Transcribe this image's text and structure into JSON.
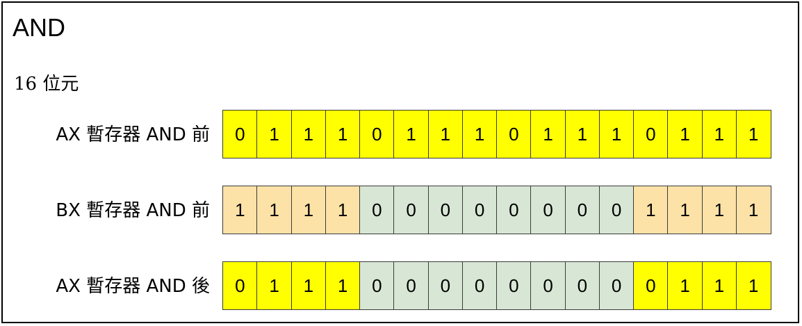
{
  "title": "AND",
  "subtitle": "16 位元",
  "colors": {
    "yellow": "#ffff00",
    "orange": "#fde2a8",
    "green": "#d8e7d5"
  },
  "rows": [
    {
      "label": "AX 暫存器 AND 前",
      "bits": [
        "0",
        "1",
        "1",
        "1",
        "0",
        "1",
        "1",
        "1",
        "0",
        "1",
        "1",
        "1",
        "0",
        "1",
        "1",
        "1"
      ],
      "fills": [
        "yellow",
        "yellow",
        "yellow",
        "yellow",
        "yellow",
        "yellow",
        "yellow",
        "yellow",
        "yellow",
        "yellow",
        "yellow",
        "yellow",
        "yellow",
        "yellow",
        "yellow",
        "yellow"
      ]
    },
    {
      "label": "BX 暫存器 AND 前",
      "bits": [
        "1",
        "1",
        "1",
        "1",
        "0",
        "0",
        "0",
        "0",
        "0",
        "0",
        "0",
        "0",
        "1",
        "1",
        "1",
        "1"
      ],
      "fills": [
        "orange",
        "orange",
        "orange",
        "orange",
        "green",
        "green",
        "green",
        "green",
        "green",
        "green",
        "green",
        "green",
        "orange",
        "orange",
        "orange",
        "orange"
      ]
    },
    {
      "label": "AX 暫存器 AND 後",
      "bits": [
        "0",
        "1",
        "1",
        "1",
        "0",
        "0",
        "0",
        "0",
        "0",
        "0",
        "0",
        "0",
        "0",
        "1",
        "1",
        "1"
      ],
      "fills": [
        "yellow",
        "yellow",
        "yellow",
        "yellow",
        "green",
        "green",
        "green",
        "green",
        "green",
        "green",
        "green",
        "green",
        "yellow",
        "yellow",
        "yellow",
        "yellow"
      ]
    }
  ]
}
